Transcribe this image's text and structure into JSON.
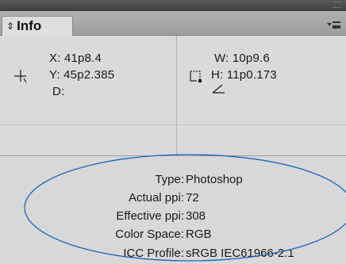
{
  "panel": {
    "tab": {
      "arrows": "⇕",
      "label": "Info"
    },
    "menu_icon": "panel-menu-icon",
    "position": {
      "x": "X: 41p8.4",
      "y": "Y: 45p2.385",
      "d": "D:"
    },
    "size": {
      "w": "W: 10p9.6",
      "h": "H: 11p0.173"
    },
    "info": [
      {
        "label": "Type:",
        "value": "Photoshop"
      },
      {
        "label": "Actual ppi:",
        "value": "72"
      },
      {
        "label": "Effective ppi:",
        "value": "308"
      },
      {
        "label": "Color Space:",
        "value": "RGB"
      },
      {
        "label": "ICC Profile:",
        "value": "sRGB IEC61966-2.1"
      }
    ],
    "colors": {
      "annotation_oval": "#1d66b8",
      "panel_bg": "#d9d9d9"
    }
  }
}
